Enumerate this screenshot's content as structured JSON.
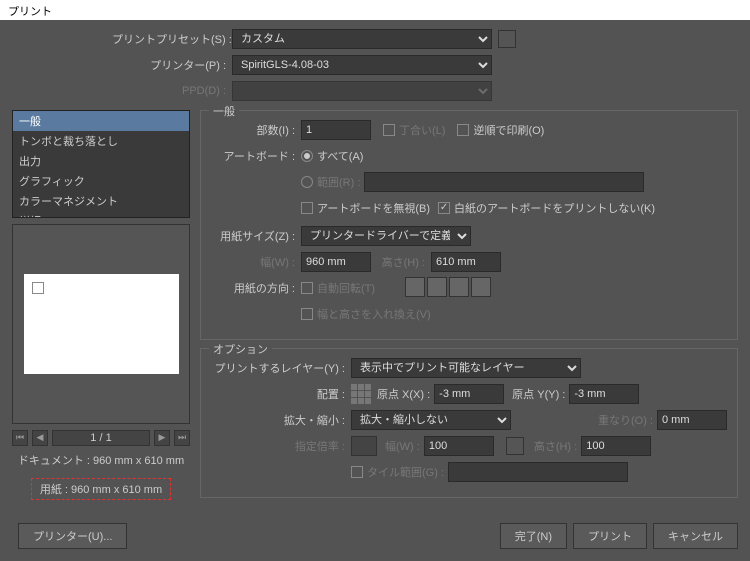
{
  "window_title": "プリント",
  "top": {
    "preset_label": "プリントプリセット(S) :",
    "preset_value": "カスタム",
    "printer_label": "プリンター(P) :",
    "printer_value": "SpiritGLS-4.08-03",
    "ppd_label": "PPD(D) :"
  },
  "sidebar": {
    "items": [
      "一般",
      "トンボと裁ち落とし",
      "出力",
      "グラフィック",
      "カラーマネジメント",
      "詳細"
    ],
    "selected": 0
  },
  "pager": {
    "text": "1 / 1"
  },
  "info": {
    "document": "ドキュメント : 960 mm x 610 mm",
    "paper": "用紙 : 960 mm x 610 mm"
  },
  "general": {
    "title": "一般",
    "copies_label": "部数(I) :",
    "copies_value": "1",
    "collate": "丁合い(L)",
    "reverse": "逆順で印刷(O)",
    "artboard_label": "アートボード :",
    "all": "すべて(A)",
    "range_label": "範囲(R) :",
    "ignore": "アートボードを無視(B)",
    "blank": "白紙のアートボードをプリントしない(K)",
    "paper_size_label": "用紙サイズ(Z) :",
    "paper_size_value": "プリンタードライバーで定義",
    "width_label": "幅(W) :",
    "width_value": "960 mm",
    "height_label": "高さ(H) :",
    "height_value": "610 mm",
    "orient_label": "用紙の方向 :",
    "auto_rotate": "自動回転(T)",
    "swap": "幅と高さを入れ換え(V)"
  },
  "options": {
    "title": "オプション",
    "layers_label": "プリントするレイヤー(Y) :",
    "layers_value": "表示中でプリント可能なレイヤー",
    "placement_label": "配置 :",
    "origin_x_label": "原点 X(X) :",
    "origin_x_value": "-3 mm",
    "origin_y_label": "原点 Y(Y) :",
    "origin_y_value": "-3 mm",
    "scale_label": "拡大・縮小 :",
    "scale_value": "拡大・縮小しない",
    "overlap_label": "重なり(O) :",
    "overlap_value": "0 mm",
    "ratio_label": "指定倍率 :",
    "ratio_w_label": "幅(W) :",
    "ratio_w_value": "100",
    "ratio_h_label": "高さ(H) :",
    "ratio_h_value": "100",
    "tile_label": "タイル範囲(G) :"
  },
  "buttons": {
    "printer": "プリンター(U)...",
    "done": "完了(N)",
    "print": "プリント",
    "cancel": "キャンセル"
  }
}
